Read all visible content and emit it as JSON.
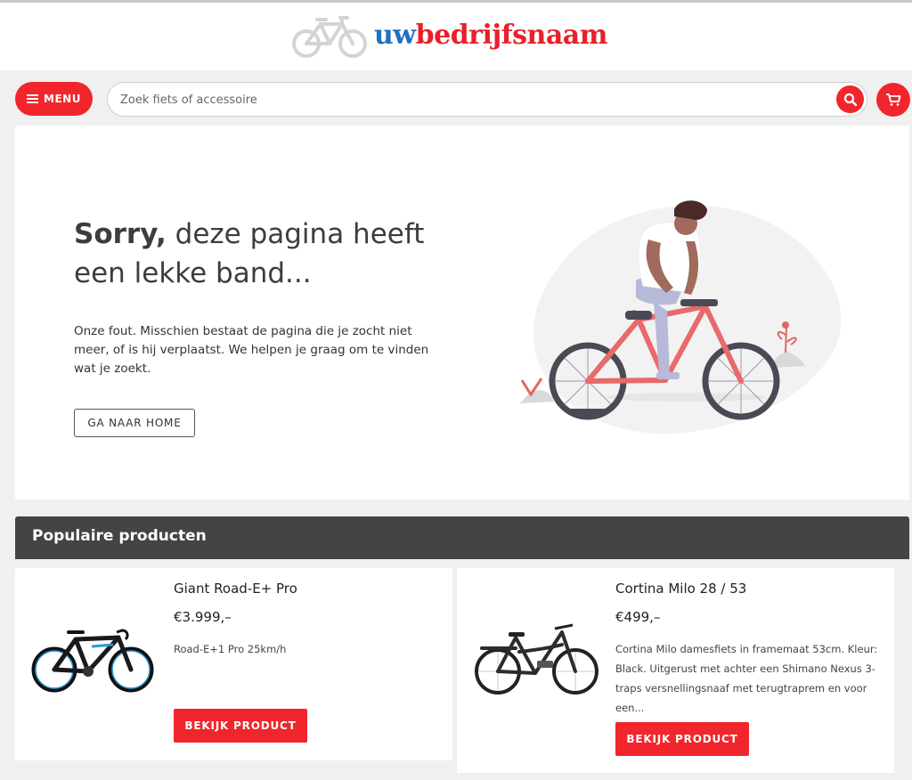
{
  "header": {
    "logo_prefix": "uw",
    "logo_name": "bedrijfsnaam"
  },
  "toolbar": {
    "menu_label": "MENU",
    "search_placeholder": "Zoek fiets of accessoire"
  },
  "hero": {
    "title_bold": "Sorry,",
    "title_rest": " deze pagina heeft een lekke band...",
    "text": "Onze fout. Misschien bestaat de pagina die je zocht niet meer, of is hij verplaatst. We helpen je graag om te vinden wat je zoekt.",
    "home_button": "GA NAAR HOME"
  },
  "popular": {
    "heading": "Populaire producten",
    "products": [
      {
        "name": "Giant Road-E+ Pro",
        "price": "€3.999,–",
        "description": "Road-E+1 Pro 25km/h",
        "button": "BEKIJK PRODUCT"
      },
      {
        "name": "Cortina Milo 28 / 53",
        "price": "€499,–",
        "description": "Cortina Milo damesfiets in framemaat 53cm. Kleur: Black. Uitgerust met achter een Shimano Nexus 3-traps versnellingsnaaf met terugtraprem en voor een...",
        "button": "BEKIJK PRODUCT"
      }
    ]
  },
  "colors": {
    "accent": "#f0262c",
    "logo_blue": "#1f6fc2",
    "header_dark": "#444444"
  }
}
